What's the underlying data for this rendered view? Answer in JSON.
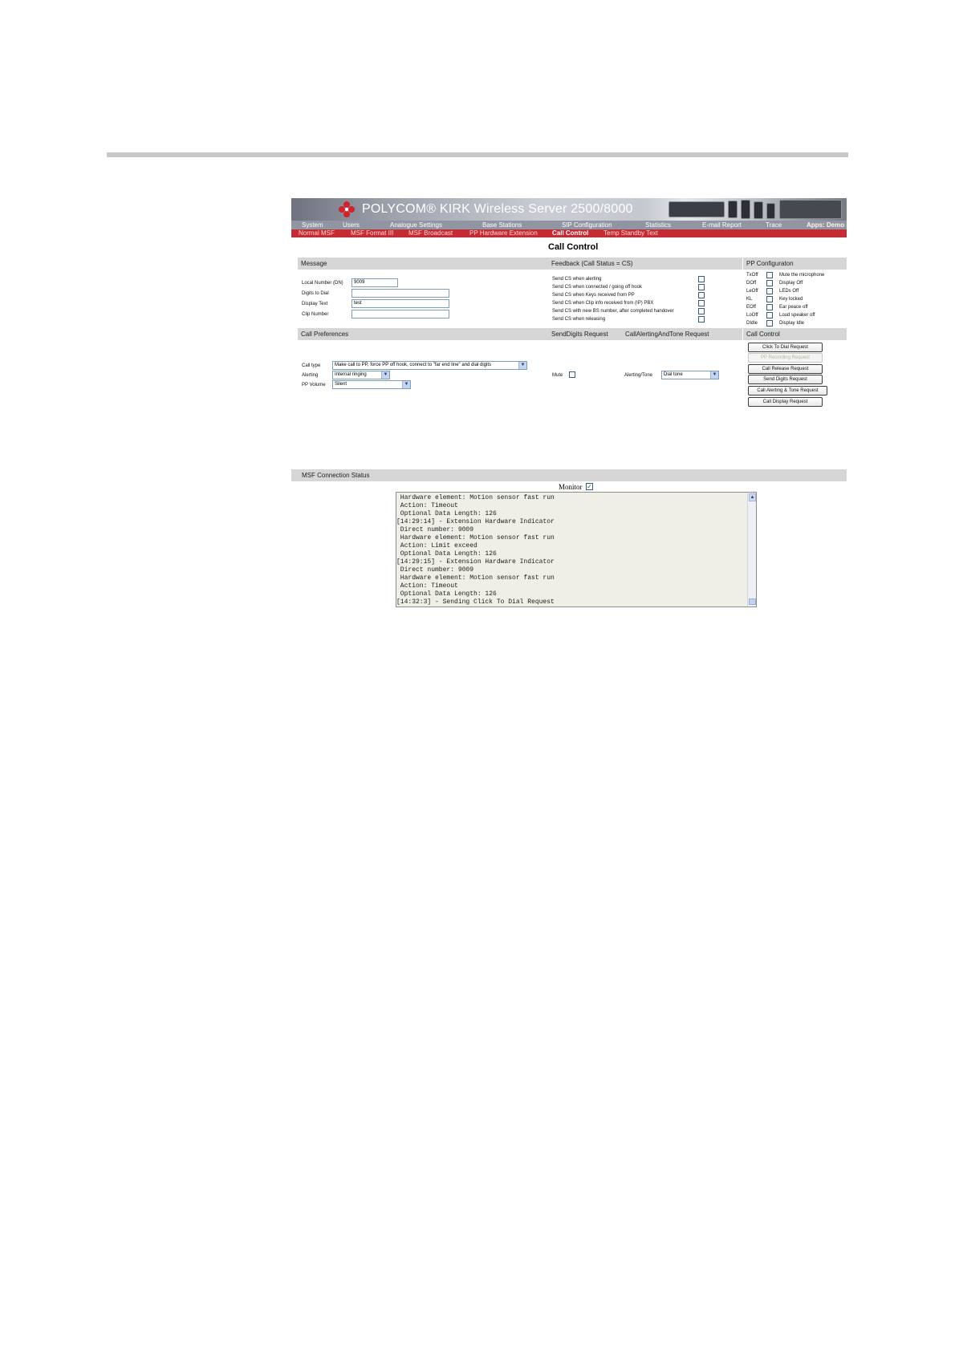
{
  "header": {
    "brand": "POLYCOM® KIRK Wireless Server 2500/8000"
  },
  "menu": {
    "items": [
      "System",
      "Users",
      "Analogue Settings",
      "Base Stations",
      "SIP Configuration",
      "Statistics",
      "E-mail Report",
      "Trace",
      "Apps: Demo"
    ]
  },
  "submenu": {
    "items": [
      "Normal MSF",
      "MSF Format III",
      "MSF Broadcast",
      "PP Hardware Extension",
      "Call Control",
      "Temp Standby Text"
    ],
    "active": "Call Control"
  },
  "page": {
    "title": "Call Control"
  },
  "message": {
    "heading": "Message",
    "fields": [
      {
        "label": "Local Number (DN)",
        "value": "9009"
      },
      {
        "label": "Digits to Dial",
        "value": ""
      },
      {
        "label": "Display Text",
        "value": "test"
      },
      {
        "label": "Clip Number",
        "value": ""
      }
    ]
  },
  "feedback": {
    "heading": "Feedback (Call Status = CS)",
    "options": [
      "Send CS when alerting",
      "Send CS when connected / going off hook",
      "Send CS when Keys received from PP",
      "Send CS when Clip info received from (IP) PBX",
      "Send CS with new BS number, after completed handover",
      "Send CS when releasing"
    ]
  },
  "pp_config": {
    "heading": "PP Configuraton",
    "items": [
      {
        "code": "TxOff",
        "label": "Mute the microphone"
      },
      {
        "code": "DOff",
        "label": "Display Off"
      },
      {
        "code": "LeOff",
        "label": "LEDs Off"
      },
      {
        "code": "KL",
        "label": "Key locked"
      },
      {
        "code": "EOff",
        "label": "Ear peace off"
      },
      {
        "code": "LoOff",
        "label": "Loud speaker off"
      },
      {
        "code": "DIdle",
        "label": "Display Idle"
      }
    ]
  },
  "call_prefs": {
    "heading": "Call Preferences",
    "call_type_label": "Call type",
    "call_type_value": "Make call to PP, force PP off hook, connect to \"far end line\" and dial digits",
    "alerting_label": "Alerting",
    "alerting_value": "Internal ringing",
    "volume_label": "PP Volume",
    "volume_value": "Silent"
  },
  "send_digits": {
    "heading": "SendDigits Request",
    "mute_label": "Mute"
  },
  "alerting_tone": {
    "heading": "CallAlertingAndTone Request",
    "label": "Alerting/Tone",
    "value": "Dial tone"
  },
  "call_control": {
    "heading": "Call Control",
    "buttons": [
      {
        "label": "Click To Dial Request",
        "enabled": true
      },
      {
        "label": "PP Recording Request",
        "enabled": false
      },
      {
        "label": "Call Release Request",
        "enabled": true
      },
      {
        "label": "Send Digits Request",
        "enabled": true
      },
      {
        "label": "Call Alerting & Tone Request",
        "enabled": true
      },
      {
        "label": "Call Display Request",
        "enabled": true
      }
    ]
  },
  "status": {
    "heading": "MSF Connection Status",
    "monitor_label": "Monitor",
    "monitor_checked": true,
    "log": [
      " Hardware element: Motion sensor fast run",
      " Action: Timeout",
      " Optional Data Length: 126",
      "[14:29:14] - Extension Hardware Indicator",
      " Direct number: 9009",
      " Hardware element: Motion sensor fast run",
      " Action: Limit exceed",
      " Optional Data Length: 126",
      "[14:29:15] - Extension Hardware Indicator",
      " Direct number: 9009",
      " Hardware element: Motion sensor fast run",
      " Action: Timeout",
      " Optional Data Length: 126",
      "[14:32:3] - Sending Click To Dial Request"
    ]
  },
  "colors": {
    "menu_bar": "#9195a1",
    "submenu_bar": "#c52b32",
    "section_header": "#d6d6d6",
    "log_background": "#efefe8"
  }
}
